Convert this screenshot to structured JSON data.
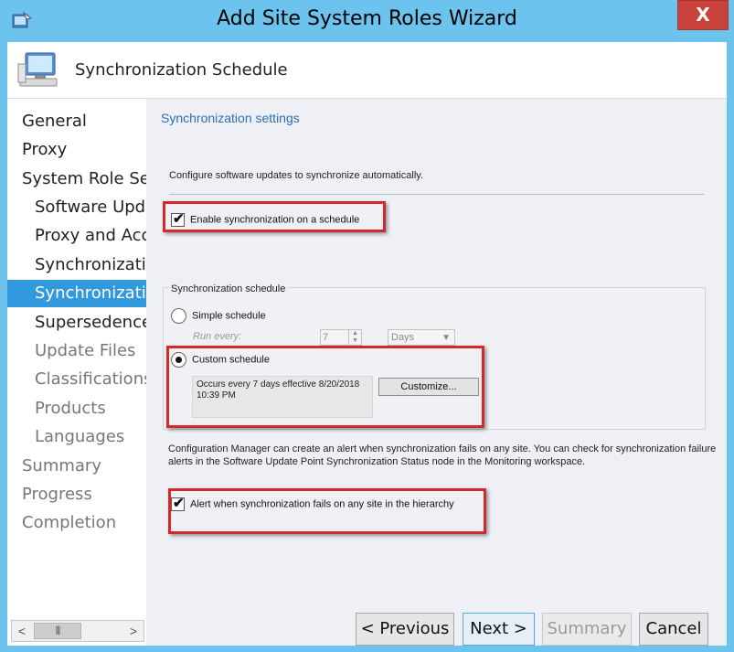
{
  "window": {
    "title": "Add Site System Roles Wizard",
    "close_label": "X"
  },
  "header": {
    "title": "Synchronization Schedule"
  },
  "nav": {
    "items": [
      {
        "label": "General",
        "state": "done"
      },
      {
        "label": "Proxy",
        "state": "done"
      },
      {
        "label": "System Role Sel",
        "state": "done"
      },
      {
        "label": "Software Upda",
        "state": "done"
      },
      {
        "label": "Proxy and Acc",
        "state": "done"
      },
      {
        "label": "Synchronizatio",
        "state": "done"
      },
      {
        "label": "Synchronizatio",
        "state": "active"
      },
      {
        "label": "Supersedence",
        "state": "done"
      },
      {
        "label": "Update Files",
        "state": "pending"
      },
      {
        "label": "Classifications",
        "state": "pending"
      },
      {
        "label": "Products",
        "state": "pending"
      },
      {
        "label": "Languages",
        "state": "pending"
      },
      {
        "label": "Summary",
        "state": "pending"
      },
      {
        "label": "Progress",
        "state": "pending"
      },
      {
        "label": "Completion",
        "state": "pending"
      }
    ],
    "scroll_left": "<",
    "scroll_right": ">",
    "scroll_thumb": "|||"
  },
  "content": {
    "section_title": "Synchronization settings",
    "description": "Configure software updates to synchronize automatically.",
    "enable_sync_label": "Enable synchronization on a schedule",
    "enable_sync_checked": true,
    "group_title": "Synchronization schedule",
    "simple_schedule_label": "Simple schedule",
    "run_every_label": "Run every:",
    "run_every_value": "7",
    "run_every_unit": "Days",
    "custom_schedule_label": "Custom schedule",
    "custom_schedule_selected": true,
    "occurs_text": "Occurs every 7 days effective 8/20/2018 10:39 PM",
    "customize_button": "Customize...",
    "alert_description": "Configuration Manager can create an alert when synchronization fails on any site. You can check for synchronization failure alerts in the Software Update Point Synchronization Status node in the Monitoring workspace.",
    "alert_checkbox_label": "Alert when synchronization fails on any site in the hierarchy",
    "alert_checked": true
  },
  "footer": {
    "previous": "< Previous",
    "next": "Next >",
    "summary": "Summary",
    "cancel": "Cancel"
  },
  "colors": {
    "titlebar": "#6cc4ee",
    "accent": "#3399dd",
    "highlight": "#d22a2a",
    "close": "#c9413b"
  }
}
